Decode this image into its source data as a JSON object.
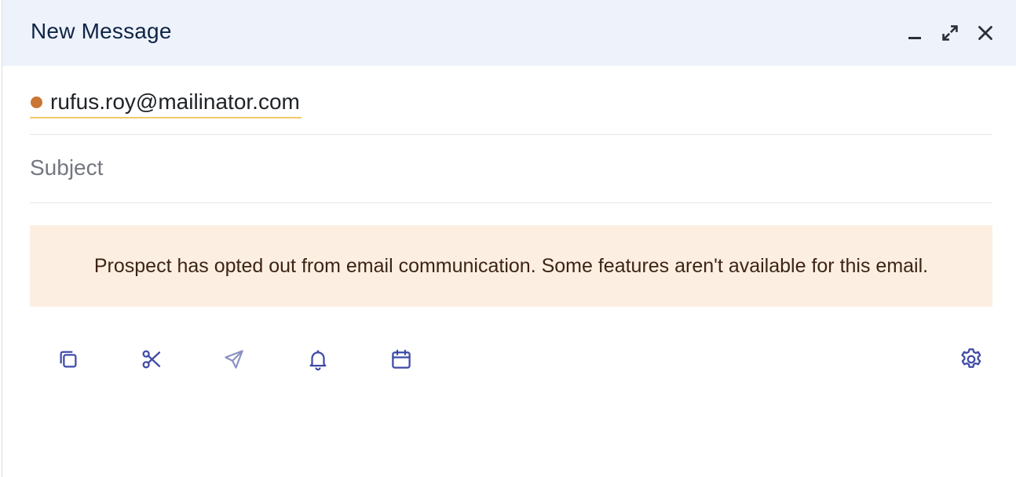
{
  "header": {
    "title": "New Message",
    "actions": [
      {
        "name": "minimize",
        "icon": "minimize-icon"
      },
      {
        "name": "expand",
        "icon": "expand-icon"
      },
      {
        "name": "close",
        "icon": "close-icon"
      }
    ]
  },
  "to": {
    "recipient_email": "rufus.roy@mailinator.com",
    "status_color": "#c97534"
  },
  "subject": {
    "value": "",
    "placeholder": "Subject"
  },
  "notice": {
    "text": "Prospect has opted out from email communication. Some features aren't available for this email."
  },
  "toolbar": {
    "items": [
      {
        "name": "templates",
        "icon": "copy-icon"
      },
      {
        "name": "snippets",
        "icon": "scissors-icon"
      },
      {
        "name": "send",
        "icon": "send-icon",
        "disabled": true
      },
      {
        "name": "reminder",
        "icon": "bell-icon"
      },
      {
        "name": "schedule",
        "icon": "calendar-icon"
      },
      {
        "name": "settings",
        "icon": "gear-icon"
      }
    ]
  },
  "colors": {
    "header_bg": "#eef3fb",
    "title": "#0f2446",
    "icon": "#3f4aa8",
    "icon_disabled": "#8a90c2",
    "notice_bg": "#fcefe2",
    "notice_text": "#3c2415",
    "recipient_underline": "#f2c96b"
  }
}
